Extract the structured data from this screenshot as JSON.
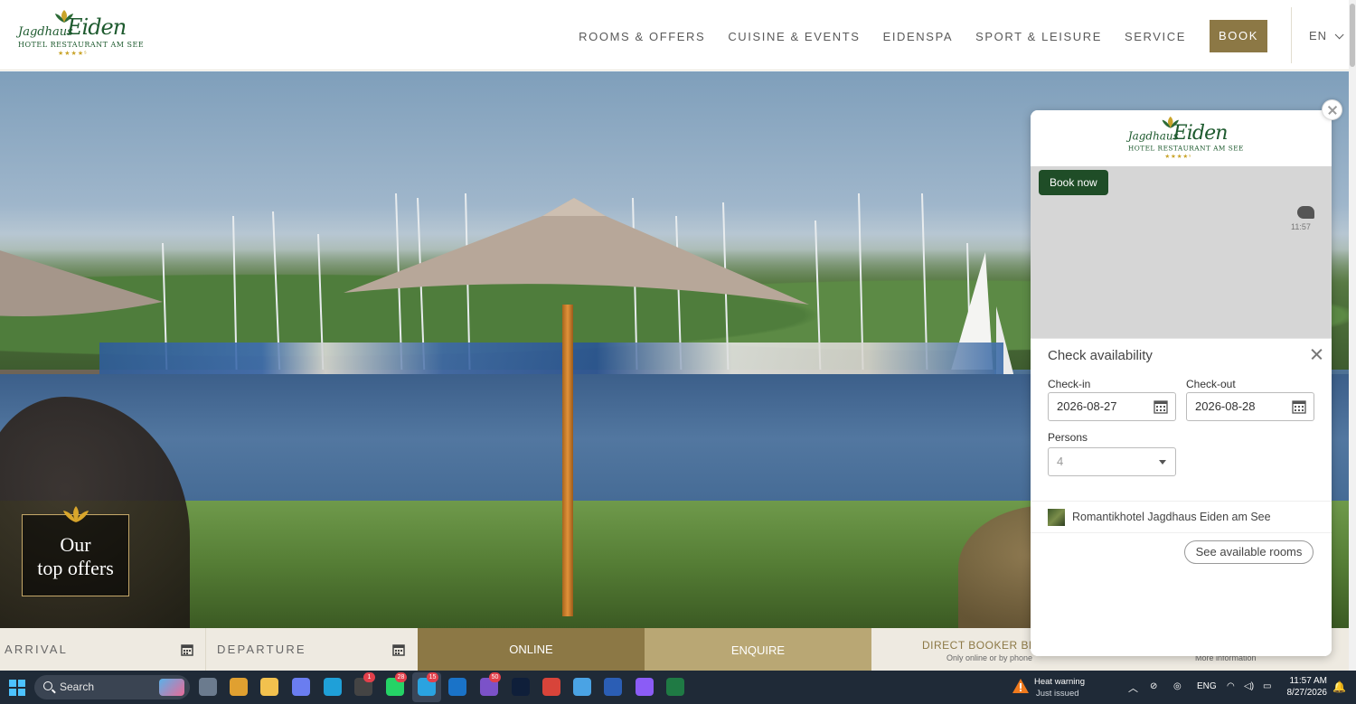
{
  "header": {
    "logo": {
      "script1": "Jagdhaus",
      "script2": "Eiden",
      "subtitle": "HOTEL RESTAURANT AM SEE",
      "stars": "★★★★ˢ"
    },
    "nav": [
      "ROOMS & OFFERS",
      "CUISINE & EVENTS",
      "EIDENSPA",
      "SPORT & LEISURE",
      "SERVICE"
    ],
    "book_label": "BOOK",
    "language": "EN"
  },
  "hero": {
    "offers_line1": "Our",
    "offers_line2": "top offers"
  },
  "bookbar": {
    "arrival": "ARRIVAL",
    "departure": "DEPARTURE",
    "online": "ONLINE",
    "enquire": "ENQUIRE",
    "direct": "DIRECT BOOKER BEN",
    "direct_sub": "Only online or by phone",
    "more_info": "More information"
  },
  "widget": {
    "logo": {
      "script1": "Jagdhaus",
      "script2": "Eiden",
      "subtitle": "HOTEL RESTAURANT AM SEE",
      "stars": "★★★★ˢ"
    },
    "book_now": "Book now",
    "chat_time": "11:57",
    "title": "Check availability",
    "checkin_label": "Check-in",
    "checkin_value": "2026-08-27",
    "checkout_label": "Check-out",
    "checkout_value": "2026-08-28",
    "persons_label": "Persons",
    "persons_value": "4",
    "hotel_name": "Romantikhotel Jagdhaus Eiden am See",
    "see_rooms": "See available rooms"
  },
  "taskbar": {
    "search": "Search",
    "apps": [
      {
        "name": "task-view",
        "color": "#6b7b8e",
        "badge": ""
      },
      {
        "name": "chrome",
        "color": "#e0a030",
        "badge": ""
      },
      {
        "name": "file-explorer",
        "color": "#f2c14e",
        "badge": ""
      },
      {
        "name": "copilot",
        "color": "#6a7df0",
        "badge": ""
      },
      {
        "name": "edge",
        "color": "#1fa0d8",
        "badge": ""
      },
      {
        "name": "app-dark",
        "color": "#444",
        "badge": "1"
      },
      {
        "name": "whatsapp",
        "color": "#25d366",
        "badge": "28"
      },
      {
        "name": "telegram",
        "color": "#2aa3e0",
        "badge": "15"
      },
      {
        "name": "outlook",
        "color": "#1a73c8",
        "badge": ""
      },
      {
        "name": "viber",
        "color": "#7b52c9",
        "badge": "50"
      },
      {
        "name": "photoshop",
        "color": "#0f1f3a",
        "badge": ""
      },
      {
        "name": "pdf-app",
        "color": "#d8443a",
        "badge": ""
      },
      {
        "name": "notepad",
        "color": "#4aa3e4",
        "badge": ""
      },
      {
        "name": "word",
        "color": "#2b5eb5",
        "badge": ""
      },
      {
        "name": "app-purple",
        "color": "#8b5cf6",
        "badge": ""
      },
      {
        "name": "excel",
        "color": "#1f7a44",
        "badge": ""
      }
    ],
    "weather_title": "Heat warning",
    "weather_sub": "Just issued",
    "lang": "ENG",
    "time": "11:57 AM",
    "date": "8/27/2026"
  }
}
